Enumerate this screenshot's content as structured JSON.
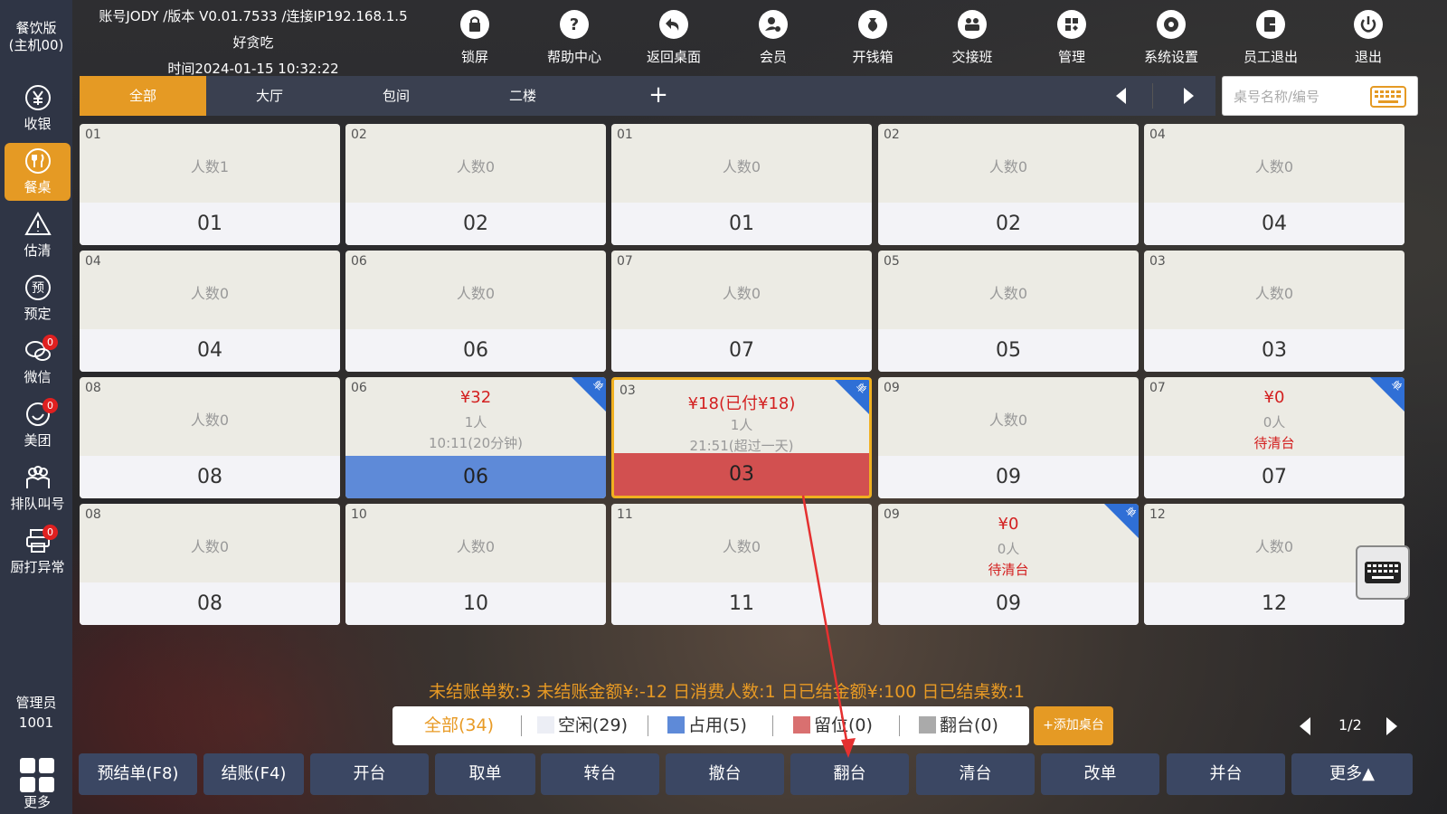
{
  "sidebar": {
    "header": [
      "餐饮版",
      "(主机00)"
    ],
    "items": [
      {
        "label": "收银",
        "icon": "yen-icon"
      },
      {
        "label": "餐桌",
        "icon": "fork-knife-icon"
      },
      {
        "label": "估清",
        "icon": "warning-icon"
      },
      {
        "label": "预定",
        "icon": "reserve-icon"
      },
      {
        "label": "微信",
        "icon": "wechat-icon",
        "badge": "0"
      },
      {
        "label": "美团",
        "icon": "meituan-icon",
        "badge": "0"
      },
      {
        "label": "排队叫号",
        "icon": "queue-icon"
      },
      {
        "label": "厨打异常",
        "icon": "printer-icon",
        "badge": "0"
      }
    ],
    "active": "餐桌",
    "admin_label": "管理员",
    "admin_id": "1001",
    "more_label": "更多"
  },
  "top": {
    "account_line": "账号JODY /版本 V0.01.7533 /连接IP192.168.1.5",
    "store": "好贪吃",
    "time_line": "时间2024-01-15 10:32:22",
    "tools": [
      {
        "label": "锁屏",
        "icon": "lock-icon"
      },
      {
        "label": "帮助中心",
        "icon": "help-icon"
      },
      {
        "label": "返回桌面",
        "icon": "return-icon"
      },
      {
        "label": "会员",
        "icon": "member-icon"
      },
      {
        "label": "开钱箱",
        "icon": "cashbox-icon"
      },
      {
        "label": "交接班",
        "icon": "handover-icon"
      },
      {
        "label": "管理",
        "icon": "manage-icon"
      },
      {
        "label": "系统设置",
        "icon": "settings-icon"
      },
      {
        "label": "员工退出",
        "icon": "staff-logout-icon"
      },
      {
        "label": "退出",
        "icon": "power-icon"
      }
    ]
  },
  "tabs": [
    "全部",
    "大厅",
    "包间",
    "二楼"
  ],
  "tab_add": "+",
  "search": {
    "placeholder": "桌号名称/编号"
  },
  "cards": [
    {
      "no": "01",
      "people": "人数1",
      "name": "01"
    },
    {
      "no": "02",
      "people": "人数0",
      "name": "02"
    },
    {
      "no": "01",
      "people": "人数0",
      "name": "01"
    },
    {
      "no": "02",
      "people": "人数0",
      "name": "02"
    },
    {
      "no": "04",
      "people": "人数0",
      "name": "04"
    },
    {
      "no": "04",
      "people": "人数0",
      "name": "04"
    },
    {
      "no": "06",
      "people": "人数0",
      "name": "06"
    },
    {
      "no": "07",
      "people": "人数0",
      "name": "07"
    },
    {
      "no": "05",
      "people": "人数0",
      "name": "05"
    },
    {
      "no": "03",
      "people": "人数0",
      "name": "03"
    },
    {
      "no": "08",
      "people": "人数0",
      "name": "08"
    },
    {
      "no": "06",
      "price": "¥32",
      "sub": "1人",
      "time": "10:11(20分钟)",
      "name": "06",
      "state": "blue",
      "corner": "单"
    },
    {
      "no": "03",
      "price": "¥18(已付¥18)",
      "sub": "1人",
      "time": "21:51(超过一天)",
      "name": "03",
      "state": "red",
      "corner": "单",
      "selected": true
    },
    {
      "no": "09",
      "people": "人数0",
      "name": "09"
    },
    {
      "no": "07",
      "price": "¥0",
      "sub": "0人",
      "time": "待清台",
      "timeRed": true,
      "name": "07",
      "corner": "单"
    },
    {
      "no": "08",
      "people": "人数0",
      "name": "08"
    },
    {
      "no": "10",
      "people": "人数0",
      "name": "10"
    },
    {
      "no": "11",
      "people": "人数0",
      "name": "11"
    },
    {
      "no": "09",
      "price": "¥0",
      "sub": "0人",
      "time": "待清台",
      "timeRed": true,
      "name": "09",
      "corner": "单"
    },
    {
      "no": "12",
      "people": "人数0",
      "name": "12"
    }
  ],
  "summary": "未结账单数:3  未结账金额¥:-12   日消费人数:1   日已结金额¥:100   日已结桌数:1",
  "legend": {
    "all": "全部(34)",
    "idle": "空闲(29)",
    "occupied": "占用(5)",
    "reserved": "留位(0)",
    "turn": "翻台(0)",
    "colors": {
      "idle": "#eceef5",
      "occupied": "#5e8ad8",
      "reserved": "#d97070",
      "turn": "#aaaaaa"
    }
  },
  "add_table": "+添加桌台",
  "pager": "1/2",
  "buttons": [
    "预结单(F8)",
    "结账(F4)",
    "开台",
    "取单",
    "转台",
    "撤台",
    "翻台",
    "清台",
    "改单",
    "并台",
    "更多▲"
  ],
  "colors": {
    "accent": "#e59a24",
    "sidebar": "#2f3545",
    "button": "#3b4763",
    "occupied_blue": "#5e8ad8",
    "occupied_red": "#d25050"
  }
}
